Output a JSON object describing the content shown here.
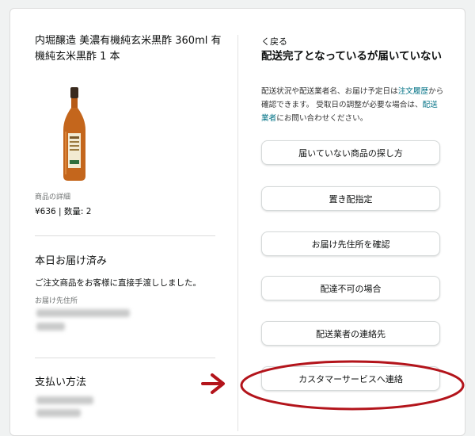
{
  "product": {
    "title": "内堀醸造 美濃有機純玄米黒酢 360ml 有機純玄米黒酢 1 本",
    "bottle_label": "美濃有機純玄米黒酢",
    "detail_label": "商品の詳細",
    "price_qty": "¥636 | 数量: 2"
  },
  "delivery": {
    "title": "本日お届け済み",
    "message": "ご注文商品をお客様に直接手渡ししました。",
    "address_label": "お届け先住所"
  },
  "payment": {
    "title": "支払い方法"
  },
  "help": {
    "back_label": "く戻る",
    "title": "配送完了となっているが届いていない",
    "desc_1": "配送状況や配送業者名、お届け予定日は",
    "desc_link_1": "注文履歴",
    "desc_2": "から確認できます。 受取日の調整が必要な場合は、",
    "desc_link_2": "配送業者",
    "desc_3": "にお問い合わせください。",
    "options": [
      "届いていない商品の探し方",
      "置き配指定",
      "お届け先住所を確認",
      "配達不可の場合",
      "配送業者の連絡先",
      "カスタマーサービスへ連絡"
    ]
  },
  "colors": {
    "link": "#007185",
    "annotation": "#b3141b",
    "bottle_amber": "#c4661c"
  }
}
